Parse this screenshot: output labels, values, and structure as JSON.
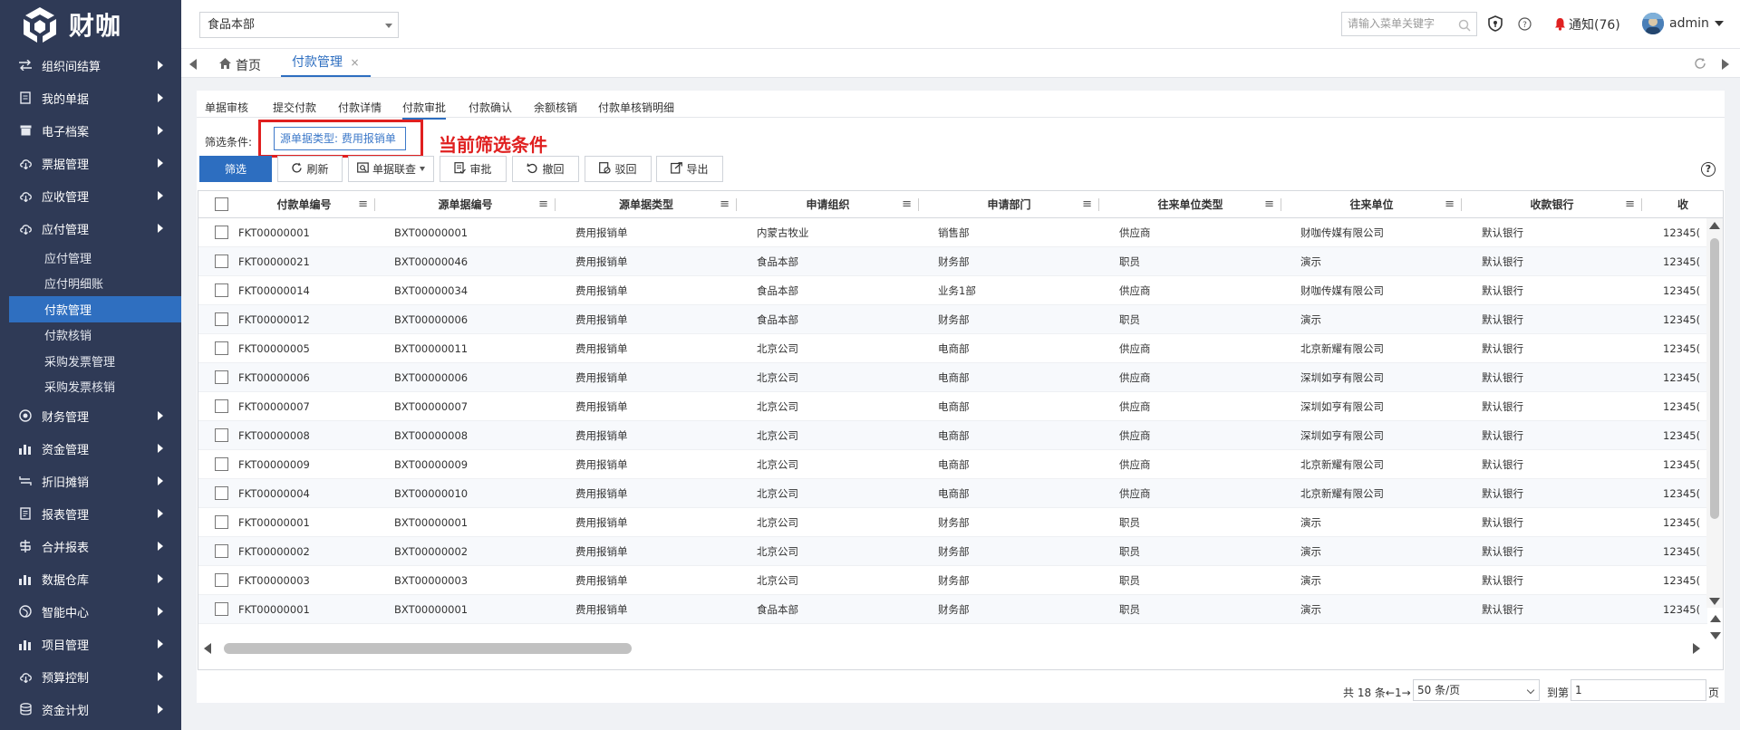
{
  "brand": {
    "logo_text": "财咖"
  },
  "sidebar": {
    "items_top": [
      {
        "label": "组织间结算",
        "icon": "transfer-icon"
      },
      {
        "label": "我的单据",
        "icon": "document-icon"
      },
      {
        "label": "电子档案",
        "icon": "archive-icon"
      },
      {
        "label": "票据管理",
        "icon": "cloud-icon"
      },
      {
        "label": "应收管理",
        "icon": "cloud-icon"
      },
      {
        "label": "应付管理",
        "icon": "cloud-icon"
      }
    ],
    "sub_items": [
      {
        "label": "应付管理",
        "active": false
      },
      {
        "label": "应付明细账",
        "active": false
      },
      {
        "label": "付款管理",
        "active": true
      },
      {
        "label": "付款核销",
        "active": false
      },
      {
        "label": "采购发票管理",
        "active": false
      },
      {
        "label": "采购发票核销",
        "active": false
      }
    ],
    "items_bottom": [
      {
        "label": "财务管理",
        "icon": "target-icon"
      },
      {
        "label": "资金管理",
        "icon": "bar-chart-icon"
      },
      {
        "label": "折旧摊销",
        "icon": "swap-icon"
      },
      {
        "label": "报表管理",
        "icon": "report-icon"
      },
      {
        "label": "合并报表",
        "icon": "merge-icon"
      },
      {
        "label": "数据仓库",
        "icon": "bar-chart-icon"
      },
      {
        "label": "智能中心",
        "icon": "globe-icon"
      },
      {
        "label": "项目管理",
        "icon": "bar-chart-icon"
      },
      {
        "label": "预算控制",
        "icon": "cloud-icon"
      },
      {
        "label": "资金计划",
        "icon": "database-icon"
      }
    ]
  },
  "header": {
    "org_select": "食品本部",
    "search_placeholder": "请输入菜单关键字",
    "notice": "通知(76)",
    "user": "admin"
  },
  "tabs": {
    "home": "首页",
    "active": "付款管理",
    "close": "×"
  },
  "subtabs": [
    "单据审核",
    "提交付款",
    "付款详情",
    "付款审批",
    "付款确认",
    "余额核销",
    "付款单核销明细"
  ],
  "subtab_active_index": 3,
  "filter": {
    "label": "筛选条件:",
    "chip": "源单据类型: 费用报销单",
    "annotation": "当前筛选条件"
  },
  "toolbar": {
    "filter": "筛选",
    "refresh": "刷新",
    "link": "单据联查",
    "approve": "审批",
    "revoke": "撤回",
    "reject": "驳回",
    "export": "导出"
  },
  "table": {
    "columns": [
      "付款单编号",
      "源单据编号",
      "源单据类型",
      "申请组织",
      "申请部门",
      "往来单位类型",
      "往来单位",
      "收款银行",
      "收"
    ],
    "rows": [
      [
        "FKT00000001",
        "BXT00000001",
        "费用报销单",
        "内蒙古牧业",
        "销售部",
        "供应商",
        "财咖传媒有限公司",
        "默认银行",
        "12345("
      ],
      [
        "FKT00000021",
        "BXT00000046",
        "费用报销单",
        "食品本部",
        "财务部",
        "职员",
        "演示",
        "默认银行",
        "12345("
      ],
      [
        "FKT00000014",
        "BXT00000034",
        "费用报销单",
        "食品本部",
        "业务1部",
        "供应商",
        "财咖传媒有限公司",
        "默认银行",
        "12345("
      ],
      [
        "FKT00000012",
        "BXT00000006",
        "费用报销单",
        "食品本部",
        "财务部",
        "职员",
        "演示",
        "默认银行",
        "12345("
      ],
      [
        "FKT00000005",
        "BXT00000011",
        "费用报销单",
        "北京公司",
        "电商部",
        "供应商",
        "北京新耀有限公司",
        "默认银行",
        "12345("
      ],
      [
        "FKT00000006",
        "BXT00000006",
        "费用报销单",
        "北京公司",
        "电商部",
        "供应商",
        "深圳如亨有限公司",
        "默认银行",
        "12345("
      ],
      [
        "FKT00000007",
        "BXT00000007",
        "费用报销单",
        "北京公司",
        "电商部",
        "供应商",
        "深圳如亨有限公司",
        "默认银行",
        "12345("
      ],
      [
        "FKT00000008",
        "BXT00000008",
        "费用报销单",
        "北京公司",
        "电商部",
        "供应商",
        "深圳如亨有限公司",
        "默认银行",
        "12345("
      ],
      [
        "FKT00000009",
        "BXT00000009",
        "费用报销单",
        "北京公司",
        "电商部",
        "供应商",
        "北京新耀有限公司",
        "默认银行",
        "12345("
      ],
      [
        "FKT00000004",
        "BXT00000010",
        "费用报销单",
        "北京公司",
        "电商部",
        "供应商",
        "北京新耀有限公司",
        "默认银行",
        "12345("
      ],
      [
        "FKT00000001",
        "BXT00000001",
        "费用报销单",
        "北京公司",
        "财务部",
        "职员",
        "演示",
        "默认银行",
        "12345("
      ],
      [
        "FKT00000002",
        "BXT00000002",
        "费用报销单",
        "北京公司",
        "财务部",
        "职员",
        "演示",
        "默认银行",
        "12345("
      ],
      [
        "FKT00000003",
        "BXT00000003",
        "费用报销单",
        "北京公司",
        "财务部",
        "职员",
        "演示",
        "默认银行",
        "12345("
      ],
      [
        "FKT00000001",
        "BXT00000001",
        "费用报销单",
        "食品本部",
        "财务部",
        "职员",
        "演示",
        "默认银行",
        "12345("
      ]
    ]
  },
  "pager": {
    "total": "共 18 条←1→",
    "page_size": "50 条/页",
    "goto": "到第",
    "page_input": "1",
    "unit": "页"
  },
  "colors": {
    "sidebar_bg": "#2f3a56",
    "accent": "#2d6ec0",
    "annotation_red": "#e02020"
  }
}
